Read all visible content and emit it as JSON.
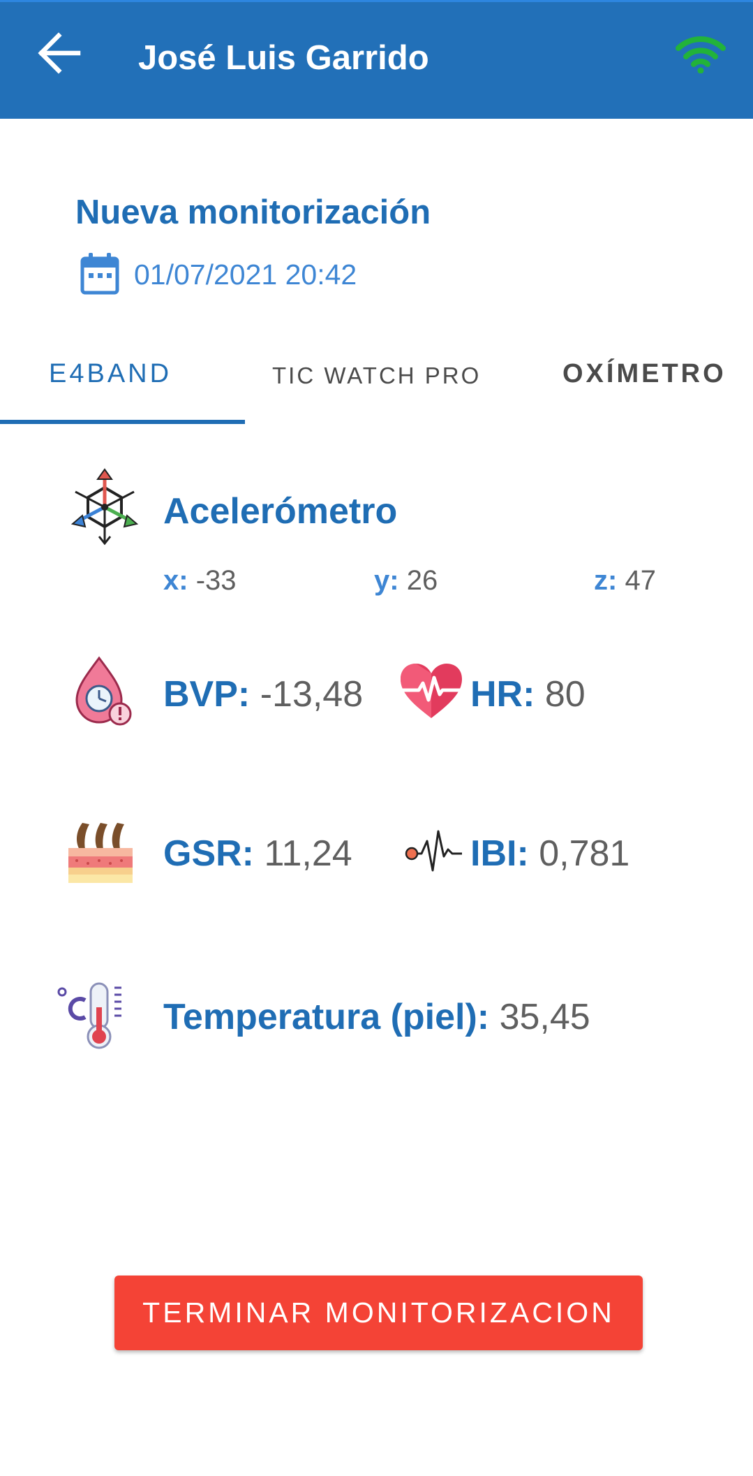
{
  "appbar": {
    "title": "José Luis Garrido",
    "back_icon": "arrow-back-icon",
    "status_icon": "wifi-icon",
    "status_color": "#22b33a"
  },
  "session": {
    "title": "Nueva monitorización",
    "datetime": "01/07/2021 20:42",
    "date_icon": "calendar-icon"
  },
  "tabs": [
    {
      "label": "E4BAND",
      "active": true
    },
    {
      "label": "TIC WATCH PRO",
      "active": false
    },
    {
      "label": "OXÍMETRO",
      "active": false
    }
  ],
  "accelerometer": {
    "title": "Acelerómetro",
    "x_label": "x:",
    "x_value": "-33",
    "y_label": "y:",
    "y_value": "26",
    "z_label": "z:",
    "z_value": "47"
  },
  "metrics": {
    "bvp": {
      "label": "BVP:",
      "value": "-13,48",
      "icon": "blood-drop-icon"
    },
    "hr": {
      "label": "HR:",
      "value": "80",
      "icon": "heart-rate-icon"
    },
    "gsr": {
      "label": "GSR:",
      "value": "11,24",
      "icon": "skin-icon"
    },
    "ibi": {
      "label": "IBI:",
      "value": "0,781",
      "icon": "pulse-wave-icon"
    },
    "temperature": {
      "label": "Temperatura (piel):",
      "value": "35,45",
      "icon": "thermometer-icon"
    }
  },
  "actions": {
    "end_label": "TERMINAR MONITORIZACION"
  },
  "colors": {
    "primary": "#2270b8",
    "accent_text": "#1f6db4",
    "danger": "#f44336"
  }
}
